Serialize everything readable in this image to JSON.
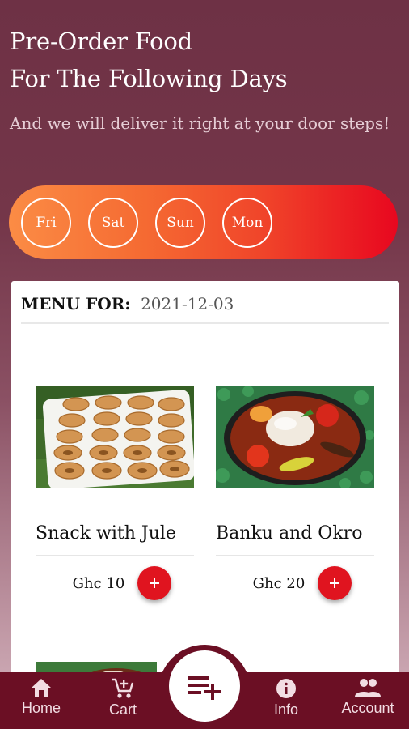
{
  "header": {
    "title_line1": "Pre-Order Food",
    "title_line2": "For The Following Days",
    "subtitle": "And we will deliver it right at your door steps!"
  },
  "days": [
    "Fri",
    "Sat",
    "Sun",
    "Mon"
  ],
  "menu": {
    "label": "MENU FOR:",
    "date": "2021-12-03",
    "items": [
      {
        "name": "Snack with Jule",
        "price": "Ghc 10",
        "add_icon": "plus-icon"
      },
      {
        "name": "Banku and Okro",
        "price": "Ghc 20",
        "add_icon": "plus-icon"
      }
    ]
  },
  "bottom_nav": {
    "items": [
      {
        "label": "Home",
        "icon": "home-icon"
      },
      {
        "label": "Cart",
        "icon": "cart-add-icon"
      },
      {
        "label": "Info",
        "icon": "info-icon"
      },
      {
        "label": "Account",
        "icon": "people-icon"
      }
    ],
    "fab_icon": "playlist-add-icon"
  },
  "colors": {
    "background": "#743649",
    "days_gradient_start": "#fb8c45",
    "days_gradient_end": "#e8071f",
    "add_button": "#e0141f",
    "nav_bar": "#6b0f24"
  }
}
